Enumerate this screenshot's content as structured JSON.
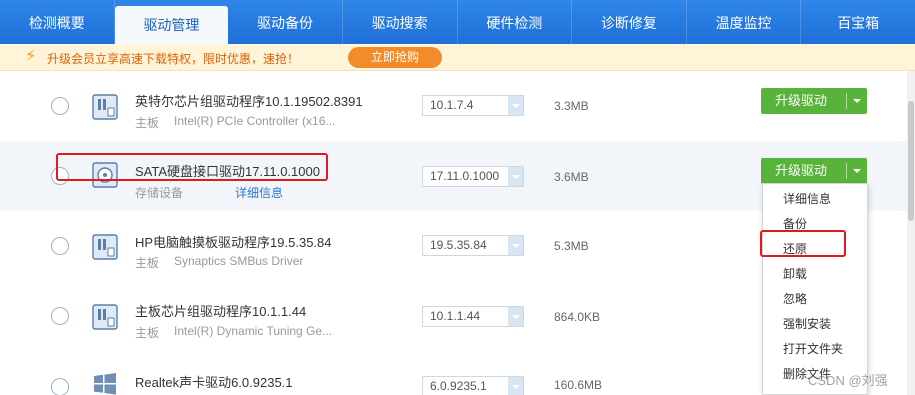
{
  "tabs": [
    {
      "label": "检测概要"
    },
    {
      "label": "驱动管理"
    },
    {
      "label": "驱动备份"
    },
    {
      "label": "驱动搜索"
    },
    {
      "label": "硬件检测"
    },
    {
      "label": "诊断修复"
    },
    {
      "label": "温度监控"
    },
    {
      "label": "百宝箱"
    }
  ],
  "active_tab": "驱动管理",
  "banner": {
    "text": "升级会员立享高速下载特权，限时优惠，速抢！",
    "button_label": "立即抢购"
  },
  "rows": [
    {
      "name": "英特尔芯片组驱动程序10.1.19502.8391",
      "category": "主板",
      "description": "Intel(R) PCIe Controller (x16...",
      "version": "10.1.7.4",
      "size": "3.3MB",
      "action": "升级驱动",
      "icon": "board-icon"
    },
    {
      "name": "SATA硬盘接口驱动17.11.0.1000",
      "category": "存储设备",
      "detail_link": "详细信息",
      "version": "17.11.0.1000",
      "size": "3.6MB",
      "action": "升级驱动",
      "icon": "disk-icon"
    },
    {
      "name": "HP电脑触摸板驱动程序19.5.35.84",
      "category": "主板",
      "description": "Synaptics SMBus Driver",
      "version": "19.5.35.84",
      "size": "5.3MB",
      "action": "升级驱动",
      "icon": "board-icon"
    },
    {
      "name": "主板芯片组驱动程序10.1.1.44",
      "category": "主板",
      "description": "Intel(R) Dynamic Tuning Ge...",
      "version": "10.1.1.44",
      "size": "864.0KB",
      "action": "升级驱动",
      "icon": "board-icon"
    },
    {
      "name": "Realtek声卡驱动6.0.9235.1",
      "category": "",
      "description": "",
      "version": "6.0.9235.1",
      "size": "160.6MB",
      "action": "升级驱动",
      "icon": "windows-icon"
    }
  ],
  "menu": {
    "items": [
      "详细信息",
      "备份",
      "还原",
      "卸载",
      "忽略",
      "强制安装",
      "打开文件夹",
      "删除文件"
    ],
    "highlighted": "还原"
  },
  "watermark": "CSDN @刘强",
  "colors": {
    "tab_bar": "#2f86e8",
    "upgrade_button": "#58b33b",
    "banner_bg": "#fff4d8",
    "promo_button": "#f28b2a",
    "annotation": "#e11b1b"
  }
}
